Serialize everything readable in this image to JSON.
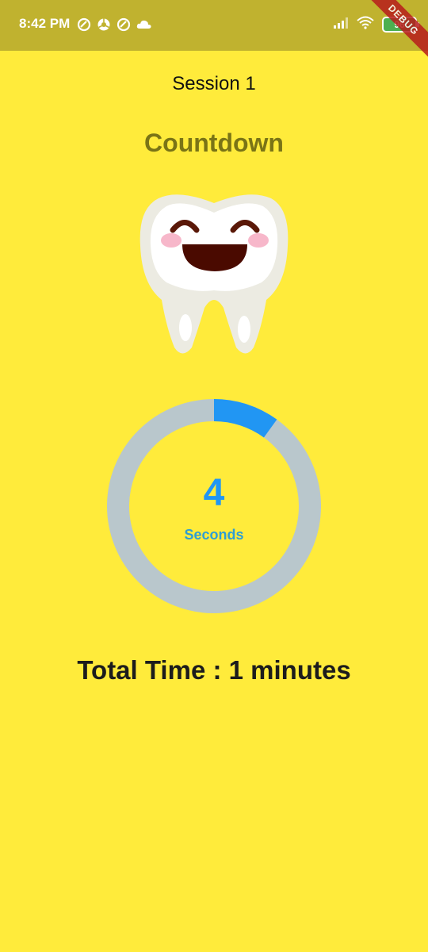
{
  "status_bar": {
    "time": "8:42 PM",
    "battery": "96",
    "left_icons": [
      "app-icon",
      "chrome-icon",
      "app-icon",
      "cloud-icon"
    ],
    "right_icons": [
      "signal-icon",
      "wifi-icon",
      "battery-icon"
    ],
    "background": "#C0B22F"
  },
  "debug_banner": "DEBUG",
  "session": {
    "title": "Session 1"
  },
  "heading": "Countdown",
  "illustration": "smiling-tooth-icon",
  "countdown": {
    "value": "4",
    "unit": "Seconds",
    "progress_fraction": 0.1,
    "progress_color": "#2196F3",
    "track_color": "#B9C7CC"
  },
  "total_time": "Total Time : 1 minutes",
  "colors": {
    "background": "#FFEB3B",
    "heading": "#7A7416",
    "accent": "#2196F3"
  }
}
